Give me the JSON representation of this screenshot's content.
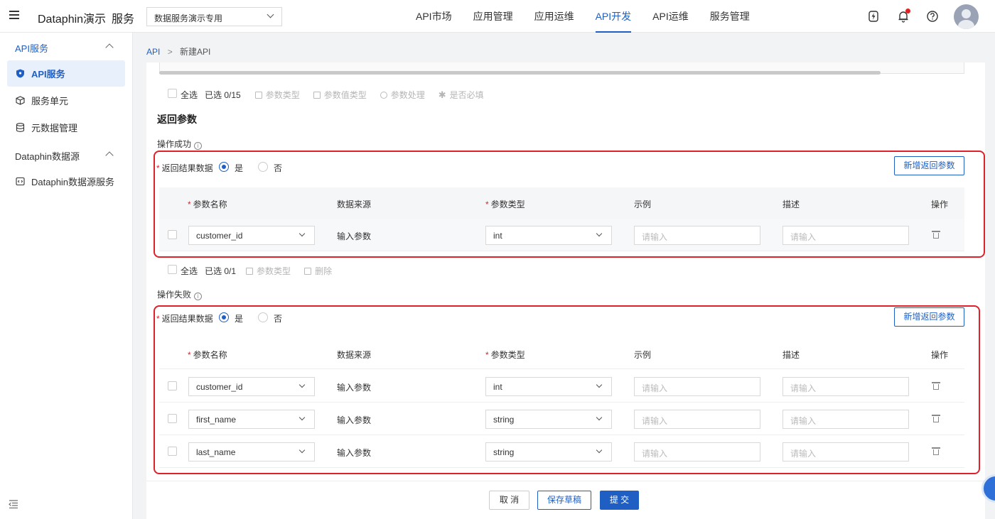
{
  "header": {
    "app_title": "Dataphin演示",
    "app_sub": "服务",
    "project": "数据服务演示专用",
    "nav": [
      "API市场",
      "应用管理",
      "应用运维",
      "API开发",
      "API运维",
      "服务管理"
    ],
    "active_nav": "API开发"
  },
  "sidebar": {
    "group1": "API服务",
    "items1": [
      "API服务",
      "服务单元",
      "元数据管理"
    ],
    "group2": "Dataphin数据源",
    "items2": [
      "Dataphin数据源服务"
    ]
  },
  "breadcrumb": {
    "root": "API",
    "sep": ">",
    "current": "新建API"
  },
  "request_toolbar": {
    "select_all": "全选",
    "selected": "已选 0/15",
    "actions": [
      "参数类型",
      "参数值类型",
      "参数处理",
      "是否必填"
    ]
  },
  "return_section": {
    "title": "返回参数",
    "success_label": "操作成功",
    "failure_label": "操作失败",
    "return_data_label": "返回结果数据",
    "yes": "是",
    "no": "否",
    "add_button": "新增返回参数",
    "columns": [
      "参数名称",
      "数据来源",
      "参数类型",
      "示例",
      "描述",
      "操作"
    ],
    "success_rows": [
      {
        "name": "customer_id",
        "source": "输入参数",
        "type": "int",
        "example_ph": "请输入",
        "desc_ph": "请输入"
      }
    ],
    "success_toolbar": {
      "select_all": "全选",
      "selected": "已选 0/1",
      "actions": [
        "参数类型",
        "删除"
      ]
    },
    "failure_rows": [
      {
        "name": "customer_id",
        "source": "输入参数",
        "type": "int",
        "example_ph": "请输入",
        "desc_ph": "请输入"
      },
      {
        "name": "first_name",
        "source": "输入参数",
        "type": "string",
        "example_ph": "请输入",
        "desc_ph": "请输入"
      },
      {
        "name": "last_name",
        "source": "输入参数",
        "type": "string",
        "example_ph": "请输入",
        "desc_ph": "请输入"
      }
    ]
  },
  "footer": {
    "cancel": "取 消",
    "save_draft": "保存草稿",
    "submit": "提 交"
  },
  "colors": {
    "primary": "#1f5fc4",
    "highlight_border": "#e0202a"
  }
}
